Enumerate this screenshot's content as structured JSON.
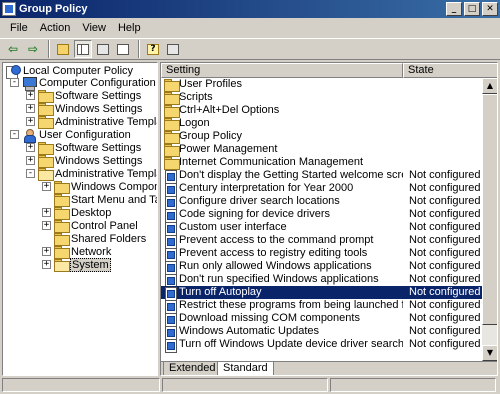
{
  "window": {
    "title": "Group Policy"
  },
  "menu": [
    "File",
    "Action",
    "View",
    "Help"
  ],
  "toolbar": {
    "icons": [
      "back-arrow-icon",
      "forward-arrow-icon",
      "up-folder-icon",
      "show-hide-tree-icon",
      "properties-icon",
      "export-list-icon",
      "help-icon",
      "help-topics-icon"
    ]
  },
  "tree": [
    {
      "label": "Local Computer Policy",
      "icon": "policy-icon"
    },
    {
      "label": "Computer Configuration",
      "icon": "computer-icon",
      "expander": "-"
    },
    {
      "label": "Software Settings",
      "icon": "folder-icon",
      "expander": "+"
    },
    {
      "label": "Windows Settings",
      "icon": "folder-icon",
      "expander": "+"
    },
    {
      "label": "Administrative Templates",
      "icon": "folder-icon",
      "expander": "+"
    },
    {
      "label": "User Configuration",
      "icon": "user-icon",
      "expander": "-"
    },
    {
      "label": "Software Settings",
      "icon": "folder-icon",
      "expander": "+"
    },
    {
      "label": "Windows Settings",
      "icon": "folder-icon",
      "expander": "+"
    },
    {
      "label": "Administrative Templates",
      "icon": "folder-icon",
      "expander": "-"
    },
    {
      "label": "Windows Components",
      "icon": "folder-icon",
      "expander": "+"
    },
    {
      "label": "Start Menu and Taskbar",
      "icon": "folder-icon"
    },
    {
      "label": "Desktop",
      "icon": "folder-icon",
      "expander": "+"
    },
    {
      "label": "Control Panel",
      "icon": "folder-icon",
      "expander": "+"
    },
    {
      "label": "Shared Folders",
      "icon": "folder-icon"
    },
    {
      "label": "Network",
      "icon": "folder-icon",
      "expander": "+"
    },
    {
      "label": "System",
      "icon": "folder-icon",
      "expander": "+",
      "selected": true
    }
  ],
  "list": {
    "columns": {
      "setting": "Setting",
      "state": "State"
    },
    "rows": [
      {
        "name": "User Profiles",
        "state": "",
        "type": "folder"
      },
      {
        "name": "Scripts",
        "state": "",
        "type": "folder"
      },
      {
        "name": "Ctrl+Alt+Del Options",
        "state": "",
        "type": "folder"
      },
      {
        "name": "Logon",
        "state": "",
        "type": "folder"
      },
      {
        "name": "Group Policy",
        "state": "",
        "type": "folder"
      },
      {
        "name": "Power Management",
        "state": "",
        "type": "folder"
      },
      {
        "name": "Internet Communication Management",
        "state": "",
        "type": "folder"
      },
      {
        "name": "Don't display the Getting Started welcome screen at logon",
        "state": "Not configured",
        "type": "setting"
      },
      {
        "name": "Century interpretation for Year 2000",
        "state": "Not configured",
        "type": "setting"
      },
      {
        "name": "Configure driver search locations",
        "state": "Not configured",
        "type": "setting"
      },
      {
        "name": "Code signing for device drivers",
        "state": "Not configured",
        "type": "setting"
      },
      {
        "name": "Custom user interface",
        "state": "Not configured",
        "type": "setting"
      },
      {
        "name": "Prevent access to the command prompt",
        "state": "Not configured",
        "type": "setting"
      },
      {
        "name": "Prevent access to registry editing tools",
        "state": "Not configured",
        "type": "setting"
      },
      {
        "name": "Run only allowed Windows applications",
        "state": "Not configured",
        "type": "setting"
      },
      {
        "name": "Don't run specified Windows applications",
        "state": "Not configured",
        "type": "setting"
      },
      {
        "name": "Turn off Autoplay",
        "state": "Not configured",
        "type": "setting",
        "selected": true
      },
      {
        "name": "Restrict these programs from being launched from Help",
        "state": "Not configured",
        "type": "setting"
      },
      {
        "name": "Download missing COM components",
        "state": "Not configured",
        "type": "setting"
      },
      {
        "name": "Windows Automatic Updates",
        "state": "Not configured",
        "type": "setting"
      },
      {
        "name": "Turn off Windows Update device driver search prompt",
        "state": "Not configured",
        "type": "setting"
      }
    ]
  },
  "tabs": [
    {
      "label": "Extended",
      "active": false
    },
    {
      "label": "Standard",
      "active": true
    }
  ],
  "colors": {
    "titlebar_start": "#0a246a",
    "titlebar_end": "#3a6ea5",
    "selection": "#0a246a",
    "chrome": "#d4d0c8"
  }
}
